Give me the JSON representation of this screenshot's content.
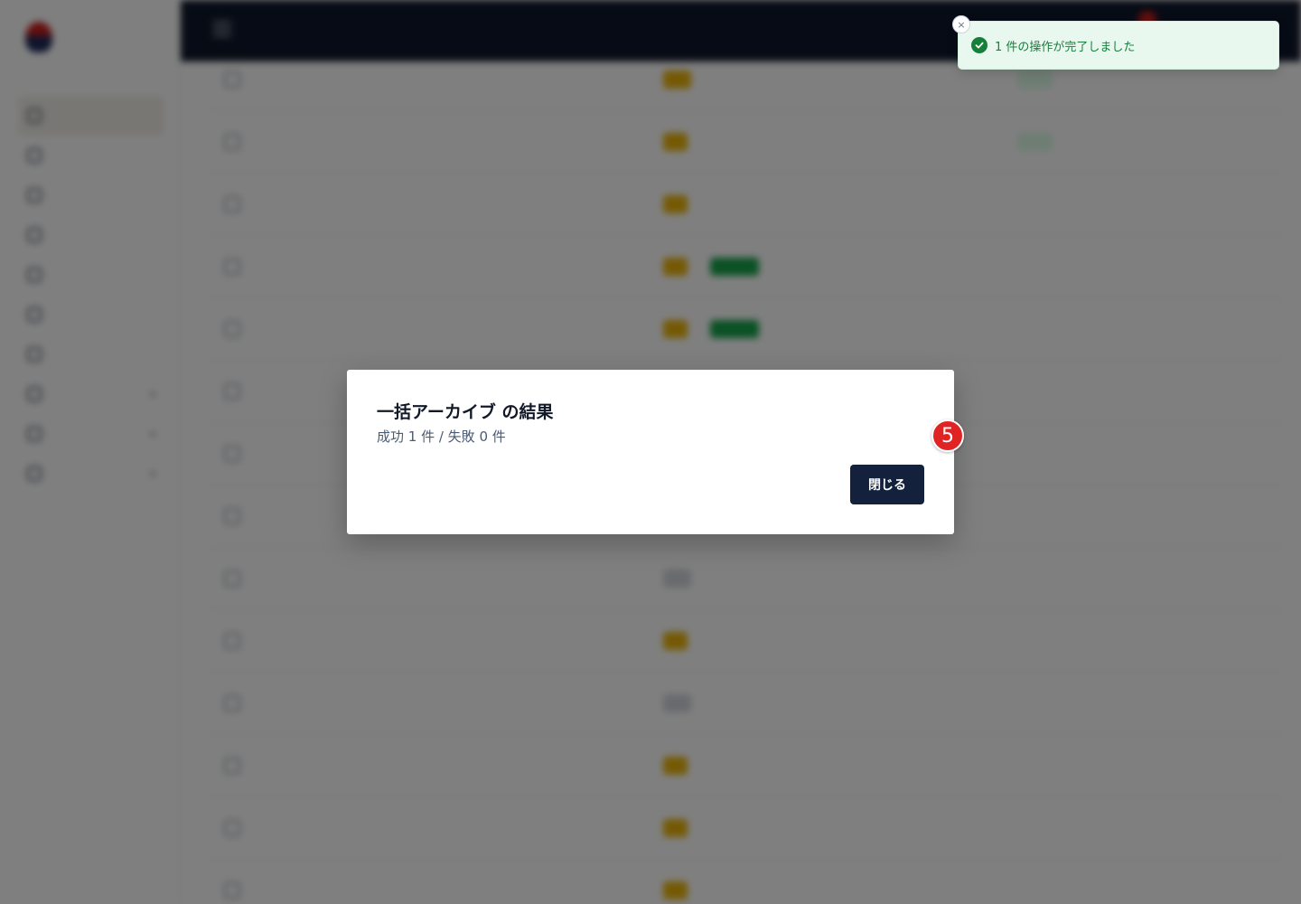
{
  "toast": {
    "message": "1 件の操作が完了しました",
    "close_glyph": "×"
  },
  "modal": {
    "title": "一括アーカイブ の結果",
    "summary": "成功 1 件 / 失敗 0 件",
    "close_label": "閉じる"
  },
  "step_badge": "5",
  "colors": {
    "topbar": "#0f172a",
    "primary_button": "#14213d",
    "toast_bg": "#e8f8ee",
    "toast_text": "#17803d",
    "badge": "#e02424"
  }
}
